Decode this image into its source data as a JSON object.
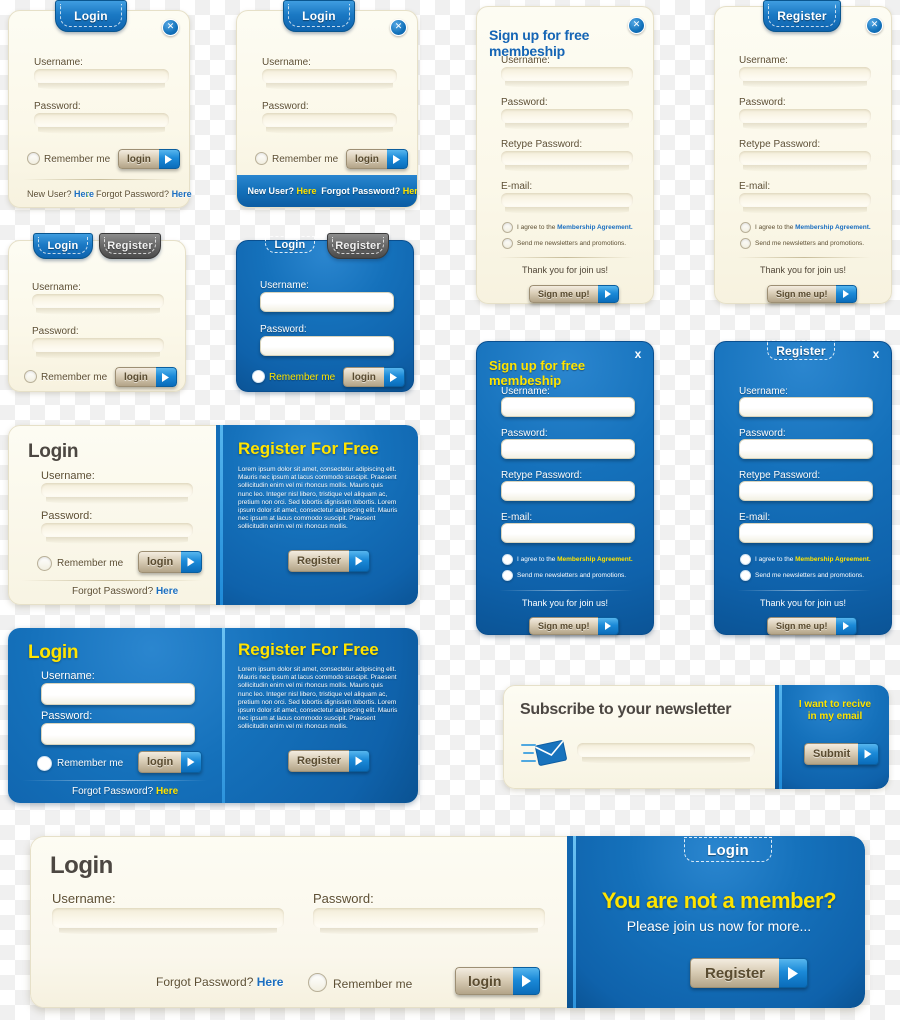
{
  "common": {
    "labels": {
      "username": "Username:",
      "password": "Password:",
      "retype_password": "Retype Password:",
      "email": "E-mail:",
      "remember_me": "Remember me",
      "forgot_password": "Forgot Password?",
      "new_user": "New User?",
      "here": "Here",
      "thank_you": "Thank you for join us!",
      "agree_prefix": "I agree to the ",
      "agree_link": "Membership Agreement.",
      "newsletters": "Send me newsletters and promotions."
    },
    "buttons": {
      "login": "login",
      "register": "Register",
      "sign_me_up": "Sign me up!",
      "submit": "Submit"
    },
    "tabs": {
      "login": "Login",
      "register": "Register"
    },
    "close": "x",
    "colors": {
      "brand_blue": "#0f62ab",
      "accent_blue": "#1b8ad8",
      "yellow": "#ffe400",
      "cream": "#fbf8e9",
      "link_blue": "#1c6fc0",
      "gray_tab": "#6a6a6a",
      "text_brown": "#5d4f33"
    },
    "lorem": "Lorem ipsum dolor sit amet, consectetur adipiscing elit. Mauris nec ipsum at lacus commodo suscipit. Praesent sollicitudin enim vel mi rhoncus mollis. Mauris quis nunc leo. Integer nisl libero, tristique vel aliquam ac, pretium non orci. Sed lobortis dignissim lobortis. Lorem ipsum dolor sit amet, consectetur adipiscing elit. Mauris nec ipsum at lacus commodo suscipit. Praesent sollicitudin enim vel mi rhoncus mollis."
  },
  "card_login_links": {
    "tab_label": "Login",
    "username": "Username:",
    "password": "Password:",
    "remember_me": "Remember me",
    "login_button": "login",
    "new_user": "New User?",
    "new_user_link": "Here",
    "forgot": "Forgot Password?",
    "forgot_link": "Here",
    "separator": ":"
  },
  "card_login_bars": {
    "tab_label": "Login",
    "username": "Username:",
    "password": "Password:",
    "remember_me": "Remember me",
    "login_button": "login",
    "bar_left": "New User? Here",
    "bar_left_plain": "New User?",
    "bar_left_link": "Here",
    "bar_right_plain": "Forgot Password?",
    "bar_right_link": "Here"
  },
  "card_signup_cream": {
    "title": "Sign up for free membeship",
    "username": "Username:",
    "password": "Password:",
    "retype_password": "Retype Password:",
    "email": "E-mail:",
    "agree_prefix": "I agree to the ",
    "agree_link": "Membership Agreement.",
    "newsletters": "Send me newsletters and promotions.",
    "thanks": "Thank you for join us!",
    "button": "Sign me up!"
  },
  "card_register_cream": {
    "tab_label": "Register",
    "username": "Username:",
    "password": "Password:",
    "retype_password": "Retype Password:",
    "email": "E-mail:",
    "agree_prefix": "I agree to the ",
    "agree_link": "Membership Agreement.",
    "newsletters": "Send me newsletters and promotions.",
    "thanks": "Thank you for join us!",
    "button": "Sign me up!"
  },
  "card_tabs_cream": {
    "tab_login": "Login",
    "tab_register": "Register",
    "username": "Username:",
    "password": "Password:",
    "remember_me": "Remember me",
    "login_button": "login"
  },
  "card_tabs_blue": {
    "tab_login": "Login",
    "tab_register": "Register",
    "username": "Username:",
    "password": "Password:",
    "remember_me": "Remember me",
    "login_button": "login"
  },
  "card_signup_blue": {
    "title": "Sign up for free membeship",
    "username": "Username:",
    "password": "Password:",
    "retype_password": "Retype Password:",
    "email": "E-mail:",
    "agree_prefix": "I agree to the ",
    "agree_link": "Membership Agreement.",
    "newsletters": "Send me newsletters and promotions.",
    "thanks": "Thank you for join us!",
    "button": "Sign me up!"
  },
  "card_register_blue": {
    "tab_label": "Register",
    "username": "Username:",
    "password": "Password:",
    "retype_password": "Retype Password:",
    "email": "E-mail:",
    "agree_prefix": "I agree to the ",
    "agree_link": "Membership Agreement.",
    "newsletters": "Send me newsletters and promotions.",
    "thanks": "Thank you for join us!",
    "button": "Sign me up!"
  },
  "combo_cream": {
    "login_title": "Login",
    "username": "Username:",
    "password": "Password:",
    "remember_me": "Remember me",
    "login_button": "login",
    "forgot": "Forgot Password?",
    "forgot_link": "Here",
    "register_title": "Register For Free",
    "register_button": "Register"
  },
  "combo_blue": {
    "login_title": "Login",
    "username": "Username:",
    "password": "Password:",
    "remember_me": "Remember me",
    "login_button": "login",
    "forgot": "Forgot Password?",
    "forgot_link": "Here",
    "register_title": "Register For Free",
    "register_button": "Register"
  },
  "newsletter": {
    "title": "Subscribe to your newsletter",
    "side_line1": "I want to recive",
    "side_line2": "in my email",
    "button": "Submit",
    "icon": "envelope-icon"
  },
  "bottom_bar": {
    "login_title": "Login",
    "username": "Username:",
    "password": "Password:",
    "forgot": "Forgot Password?",
    "forgot_link": "Here",
    "remember_me": "Remember me",
    "login_button": "login",
    "panel_tab": "Login",
    "panel_headline": "You are not a member?",
    "panel_sub": "Please join us now for more...",
    "panel_button": "Register"
  }
}
